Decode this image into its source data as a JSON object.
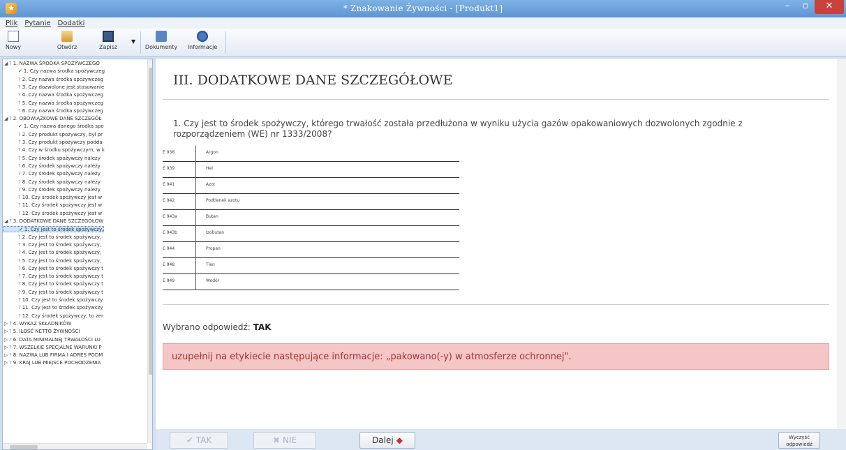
{
  "window": {
    "title": "* Znakowanie Żywności - [Produkt1]",
    "min": "–",
    "max": "▫",
    "close": "✕"
  },
  "menu": [
    "Plik",
    "Pytanie",
    "Dodatki"
  ],
  "toolbar": {
    "new": "Nowy",
    "open": "Otwórz",
    "save": "Zapisz",
    "docs": "Dokumenty",
    "info": "Informacje"
  },
  "tree": [
    {
      "exp": "◢",
      "mark": "?",
      "text": "1. NAZWA ŚRODKA SPOŻYWCZEGO",
      "level": 0
    },
    {
      "mark": "✔",
      "text": "1. Czy nazwa środka spożywczeg",
      "level": 1,
      "checked": true
    },
    {
      "mark": "?",
      "text": "2. Czy nazwa środka spożywczeg",
      "level": 1
    },
    {
      "mark": "?",
      "text": "3. Czy dozwolone jest stosowanie",
      "level": 1
    },
    {
      "mark": "?",
      "text": "4. Czy nazwa środka spożywczeg",
      "level": 1
    },
    {
      "mark": "?",
      "text": "5. Czy nazwa środka spożywczeg",
      "level": 1
    },
    {
      "mark": "?",
      "text": "6. Czy nazwa środka spożywczeg",
      "level": 1
    },
    {
      "exp": "◢",
      "mark": "?",
      "text": "2. OBOWIĄZKOWE DANE SZCZEGÓŁ",
      "level": 0
    },
    {
      "mark": "✔",
      "text": "1. Czy nazwa danego środka spo",
      "level": 1,
      "checked": true
    },
    {
      "mark": "?",
      "text": "2. Czy produkt spożywczy, był pr",
      "level": 1
    },
    {
      "mark": "?",
      "text": "3. Czy produkt spożywczy podda",
      "level": 1
    },
    {
      "mark": "?",
      "text": "4. Czy w środku spożywczym, w k",
      "level": 1
    },
    {
      "mark": "?",
      "text": "5. Czy środek spożywczy należy",
      "level": 1
    },
    {
      "mark": "?",
      "text": "6. Czy środek spożywczy należy",
      "level": 1
    },
    {
      "mark": "?",
      "text": "7. Czy środek spożywczy należy",
      "level": 1
    },
    {
      "mark": "?",
      "text": "8. Czy środek spożywczy należy",
      "level": 1
    },
    {
      "mark": "?",
      "text": "9. Czy środek spożywczy należy",
      "level": 1
    },
    {
      "mark": "?",
      "text": "10. Czy środek spożywczy jest w",
      "level": 1
    },
    {
      "mark": "?",
      "text": "11. Czy środek spożywczy jest w",
      "level": 1
    },
    {
      "mark": "?",
      "text": "12. Czy środek spożywczy jest w",
      "level": 1
    },
    {
      "exp": "◢",
      "mark": "?",
      "text": "3. DODATKOWE DANE SZCZEGÓŁOW",
      "level": 0
    },
    {
      "mark": "✔",
      "text": "1. Czy jest to środek spożywczy,",
      "level": 1,
      "checked": true,
      "selected": true
    },
    {
      "mark": "?",
      "text": "2. Czy jest to środek spożywczy,",
      "level": 1
    },
    {
      "mark": "?",
      "text": "3. Czy jest to środek spożywczy,",
      "level": 1
    },
    {
      "mark": "?",
      "text": "4. Czy jest to środek spożywczy,",
      "level": 1
    },
    {
      "mark": "?",
      "text": "5. Czy jest to środek spożywczy,",
      "level": 1
    },
    {
      "mark": "?",
      "text": "6. Czy jest to środek spożywczy t",
      "level": 1
    },
    {
      "mark": "?",
      "text": "7. Czy jest to środek spożywczy t",
      "level": 1
    },
    {
      "mark": "?",
      "text": "8. Czy jest to środek spożywczy t",
      "level": 1
    },
    {
      "mark": "?",
      "text": "9. Czy jest to środek spożywczy t",
      "level": 1
    },
    {
      "mark": "?",
      "text": "10. Czy jest to środek spożywczy",
      "level": 1
    },
    {
      "mark": "?",
      "text": "11. Czy jest to środek spożywczy",
      "level": 1
    },
    {
      "mark": "?",
      "text": "12. Czy środek spożywczy, to zer",
      "level": 1
    },
    {
      "exp": "▷",
      "mark": "?",
      "text": "4. WYKAZ SKŁADNIKÓW",
      "level": 0
    },
    {
      "exp": "▷",
      "mark": "?",
      "text": "5. ILOŚĆ NETTO ŻYWNOŚCI",
      "level": 0
    },
    {
      "exp": "▷",
      "mark": "?",
      "text": "6. DATA MINIMALNEJ TRWAŁOŚCI LU",
      "level": 0
    },
    {
      "exp": "▷",
      "mark": "?",
      "text": "7. WSZELKIE SPECJALNE WARUNKI P",
      "level": 0
    },
    {
      "exp": "▷",
      "mark": "?",
      "text": "8. NAZWA LUB FIRMA I ADRES PODM",
      "level": 0
    },
    {
      "exp": "▷",
      "mark": "?",
      "text": "9. KRAJ LUB MIEJSCE POCHODZENIA",
      "level": 0
    }
  ],
  "content": {
    "section_title": "III. DODATKOWE DANE SZCZEGÓŁOWE",
    "question": "1.  Czy jest to środek spożywczy, którego trwałość została przedłużona w wyniku użycia gazów opakowaniowych dozwolonych zgodnie z rozporządzeniem (WE) nr 1333/2008?",
    "gases": [
      {
        "code": "E 938",
        "name": "Argon"
      },
      {
        "code": "E 939",
        "name": "Hel"
      },
      {
        "code": "E 941",
        "name": "Azot"
      },
      {
        "code": "E 942",
        "name": "Podtlenek azotu"
      },
      {
        "code": "E 943a",
        "name": "Butan"
      },
      {
        "code": "E 943b",
        "name": "Izobutan"
      },
      {
        "code": "E 944",
        "name": "Propan"
      },
      {
        "code": "E 948",
        "name": "Tlen"
      },
      {
        "code": "E 949",
        "name": "Wodór"
      }
    ],
    "answer_label": "Wybrano odpowiedź:",
    "answer_value": "TAK",
    "alert": "uzupełnij na etykiecie następujące informacje: „pakowano(-y) w atmosferze ochronnej\"."
  },
  "bottom": {
    "yes_mark": "✔",
    "yes": "TAK",
    "no_mark": "✖",
    "no": "NIE",
    "next": "Dalej",
    "next_arrow": "◆",
    "clear_line1": "Wyczyść",
    "clear_line2": "odpowiedź"
  },
  "colors": {
    "alert_bg": "#f4c6c6",
    "alert_text": "#aa3333",
    "check_green": "#2e9a2e",
    "titlebar": "#6aa1db"
  }
}
